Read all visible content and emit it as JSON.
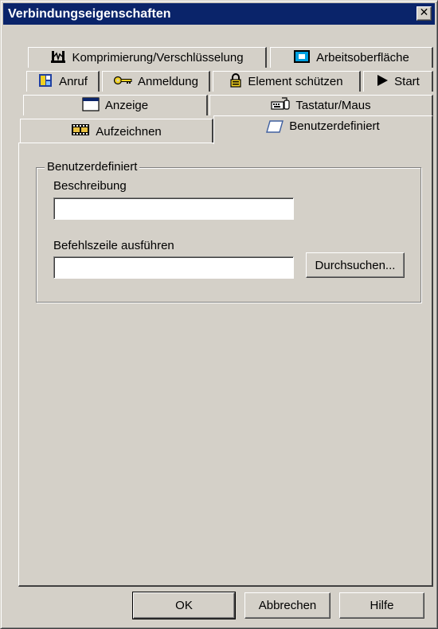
{
  "window": {
    "title": "Verbindungseigenschaften",
    "close_glyph": "✕"
  },
  "tabs": {
    "row1": [
      {
        "label": "Komprimierung/Verschlüsselung",
        "icon": "compression-icon"
      },
      {
        "label": "Arbeitsoberfläche",
        "icon": "desktop-icon"
      }
    ],
    "row2": [
      {
        "label": "Anruf",
        "icon": "phone-book-icon"
      },
      {
        "label": "Anmeldung",
        "icon": "key-icon"
      },
      {
        "label": "Element schützen",
        "icon": "lock-icon"
      },
      {
        "label": "Start",
        "icon": "play-icon"
      }
    ],
    "row3": [
      {
        "label": "Anzeige",
        "icon": "window-icon"
      },
      {
        "label": "Tastatur/Maus",
        "icon": "keyboard-mouse-icon"
      }
    ],
    "row4": [
      {
        "label": "Aufzeichnen",
        "icon": "film-icon"
      },
      {
        "label": "Benutzerdefiniert",
        "icon": "custom-icon",
        "selected": true
      }
    ]
  },
  "panel": {
    "group_title": "Benutzerdefiniert",
    "description_label": "Beschreibung",
    "description_value": "",
    "command_label": "Befehlszeile ausführen",
    "command_value": "",
    "browse_button": "Durchsuchen..."
  },
  "footer": {
    "ok": "OK",
    "cancel": "Abbrechen",
    "help": "Hilfe"
  },
  "colors": {
    "title_bar": "#0a246a",
    "face": "#d4d0c8"
  }
}
